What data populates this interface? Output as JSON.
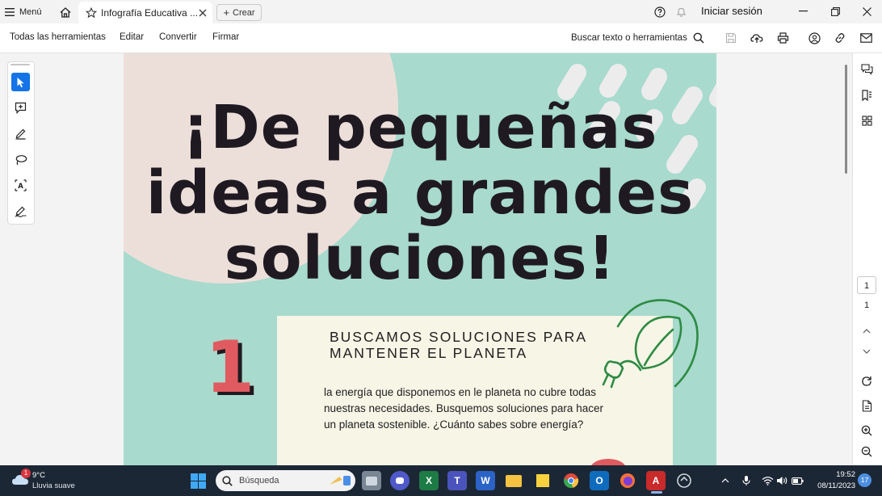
{
  "titlebar": {
    "menu_label": "Menú",
    "tab_title": "Infografía Educativa ...",
    "create_label": "Crear",
    "signin_label": "Iniciar sesión"
  },
  "menubar": {
    "items": [
      "Todas las herramientas",
      "Editar",
      "Convertir",
      "Firmar"
    ],
    "search_label": "Buscar texto o herramientas"
  },
  "document": {
    "headline_lines": [
      "¡De pequeñas",
      "ideas a grandes",
      "soluciones!"
    ],
    "step_number": "1",
    "card_heading_lines": [
      "BUSCAMOS SOLUCIONES PARA",
      "MANTENER EL PLANETA"
    ],
    "card_body_lines": [
      "la energía que disponemos en le planeta no cubre todas",
      "nuestras necesidades. Busquemos soluciones para hacer",
      "un planeta sostenible. ¿Cuánto sabes sobre energía?"
    ]
  },
  "pagenav": {
    "current_page": "1",
    "total_pages": "1"
  },
  "taskbar": {
    "weather_temp": "9°C",
    "weather_desc": "Lluvia suave",
    "weather_badge": "1",
    "search_placeholder": "Búsqueda",
    "time": "19:52",
    "date": "08/11/2023",
    "notification_count": "17"
  },
  "colors": {
    "doc_background": "#a8dacd",
    "blob": "#ecdfd9",
    "card": "#f7f5e6",
    "accent_red": "#e05b5f",
    "leaf_green": "#2e8b45",
    "tool_selected": "#1473e6",
    "taskbar": "#1c2735"
  }
}
